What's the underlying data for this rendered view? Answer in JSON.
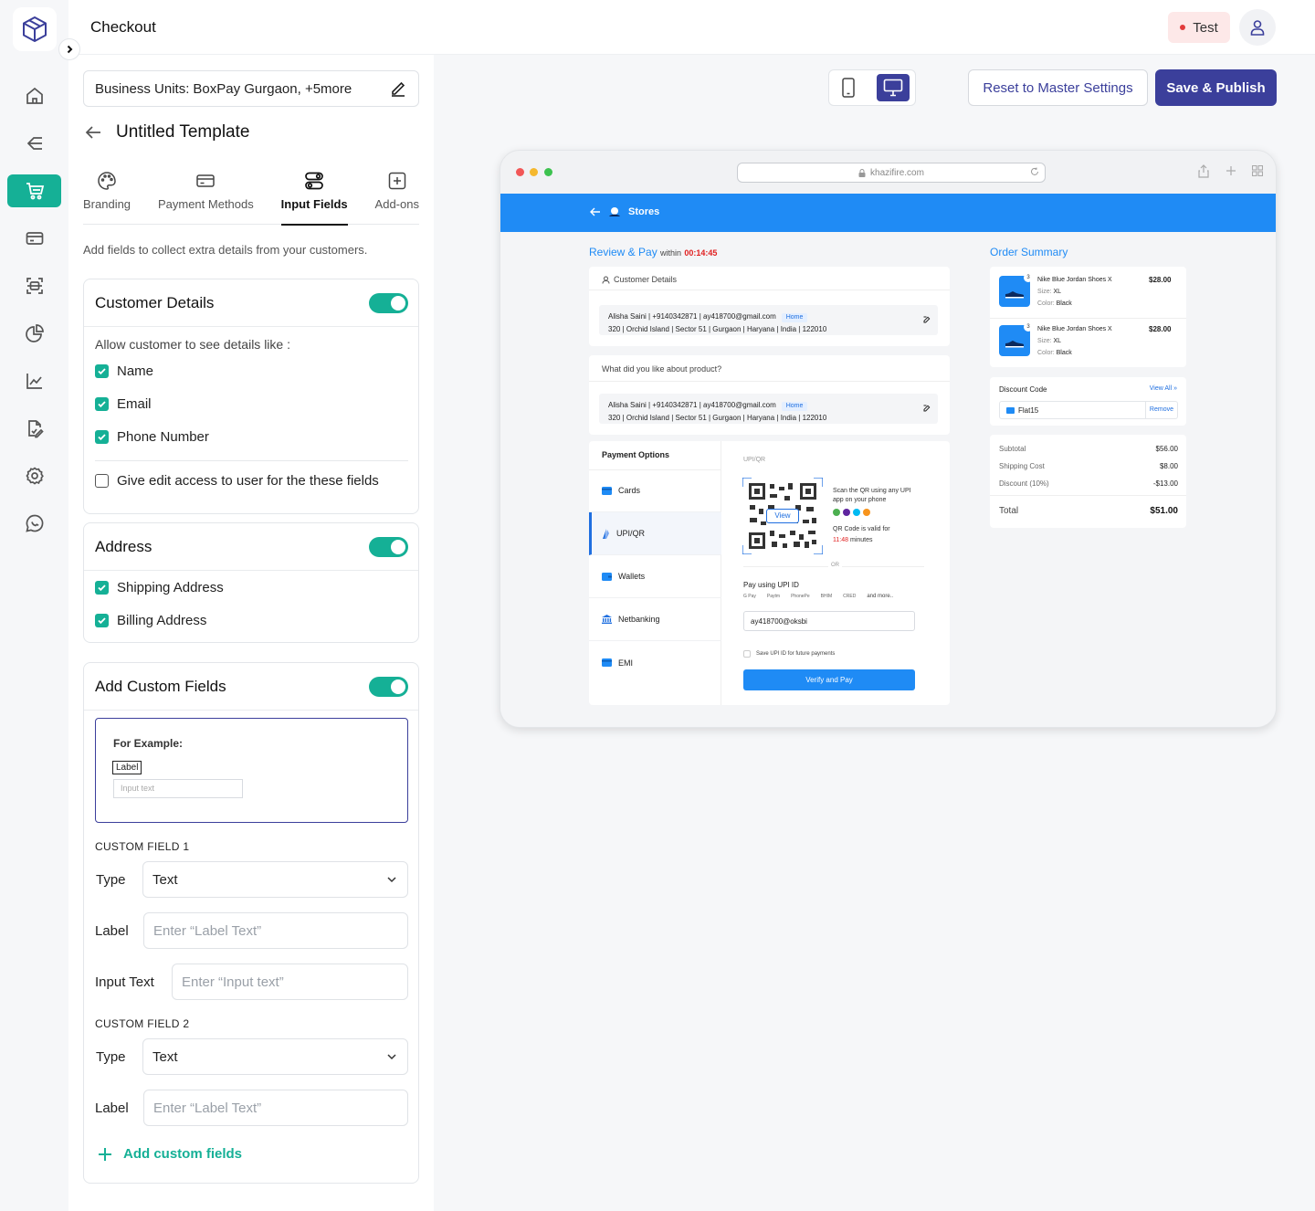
{
  "header": {
    "title": "Checkout",
    "env_badge": "Test"
  },
  "nav": {
    "items": [
      "home",
      "flows",
      "checkout",
      "payments",
      "scanner",
      "reports",
      "analytics",
      "documents",
      "settings",
      "support"
    ],
    "active": "checkout"
  },
  "panel": {
    "business_units_label": "Business Units:",
    "business_units_value": "BoxPay Gurgaon, +5more",
    "template_name": "Untitled Template",
    "tabs": [
      "Branding",
      "Payment Methods",
      "Input Fields",
      "Add-ons"
    ],
    "active_tab": "Input Fields",
    "helper": "Add fields to collect extra details from your customers.",
    "customer_details": {
      "title": "Customer Details",
      "enabled": true,
      "prompt": "Allow customer to see details like :",
      "fields": [
        {
          "label": "Name",
          "checked": true
        },
        {
          "label": "Email",
          "checked": true
        },
        {
          "label": "Phone Number",
          "checked": true
        }
      ],
      "edit_access": {
        "label": "Give edit access to user for the these fields",
        "checked": false
      }
    },
    "address": {
      "title": "Address",
      "enabled": true,
      "fields": [
        {
          "label": "Shipping Address",
          "checked": true
        },
        {
          "label": "Billing Address",
          "checked": true
        }
      ]
    },
    "custom_fields": {
      "title": "Add Custom Fields",
      "enabled": true,
      "example": {
        "title": "For Example:",
        "label": "Label",
        "input": "Input text"
      },
      "field1": {
        "heading": "CUSTOM FIELD 1",
        "type_label": "Type",
        "type_value": "Text",
        "label_label": "Label",
        "label_placeholder": "Enter “Label Text”",
        "input_label": "Input Text",
        "input_placeholder": "Enter “Input text”"
      },
      "field2": {
        "heading": "CUSTOM FIELD 2",
        "type_label": "Type",
        "type_value": "Text",
        "label_label": "Label",
        "label_placeholder": "Enter “Label Text”"
      },
      "add_label": "Add custom fields"
    }
  },
  "toolbar": {
    "reset_label": "Reset to Master Settings",
    "save_label": "Save & Publish"
  },
  "preview": {
    "url": "khazifire.com",
    "store_name": "Stores",
    "review_title": "Review & Pay",
    "within": "within",
    "timer": "00:14:45",
    "customer_details_title": "Customer Details",
    "address_line1": "Alisha Saini | +9140342871 | ay418700@gmail.com",
    "address_tag": "Home",
    "address_line2": "320 | Orchid Island | Sector 51 | Gurgaon | Haryana | India | 122010",
    "question": "What did you like about product?",
    "payment_options_title": "Payment Options",
    "payment_options": [
      "Cards",
      "UPI/QR",
      "Wallets",
      "Netbanking",
      "EMI"
    ],
    "active_option": "UPI/QR",
    "upi_section": "UPI/QR",
    "qr_view": "View",
    "scan_text": "Scan the QR using any UPI app on your phone",
    "qr_valid": "QR Code is valid for",
    "qr_time": "11:48",
    "qr_minutes": "minutes",
    "or": "OR",
    "upi_id_title": "Pay using UPI ID",
    "upi_apps": [
      "G Pay",
      "Paytm",
      "PhonePe",
      "BHIM",
      "CRED"
    ],
    "and_more": "and more..",
    "upi_id_value": "ay418700@oksbi",
    "save_upi": "Save UPI ID for future payments",
    "verify_label": "Verify and Pay",
    "order_summary_title": "Order Summary",
    "items": [
      {
        "qty": "3",
        "name": "Nike Blue Jordan Shoes X",
        "size_label": "Size:",
        "size": "XL",
        "color_label": "Color:",
        "color": "Black",
        "price": "$28.00"
      },
      {
        "qty": "3",
        "name": "Nike Blue Jordan Shoes X",
        "size_label": "Size:",
        "size": "XL",
        "color_label": "Color:",
        "color": "Black",
        "price": "$28.00"
      }
    ],
    "discount_code_title": "Discount Code",
    "view_all": "View All",
    "coupon": "Flat15",
    "remove": "Remove",
    "subtotal_label": "Subtotal",
    "subtotal": "$56.00",
    "shipping_label": "Shipping Cost",
    "shipping": "$8.00",
    "discount_label": "Discount (10%)",
    "discount": "-$13.00",
    "total_label": "Total",
    "total": "$51.00"
  },
  "colors": {
    "accent": "#15b096",
    "brand": "#3b3f9b",
    "preview_brand": "#1f8bf5"
  }
}
